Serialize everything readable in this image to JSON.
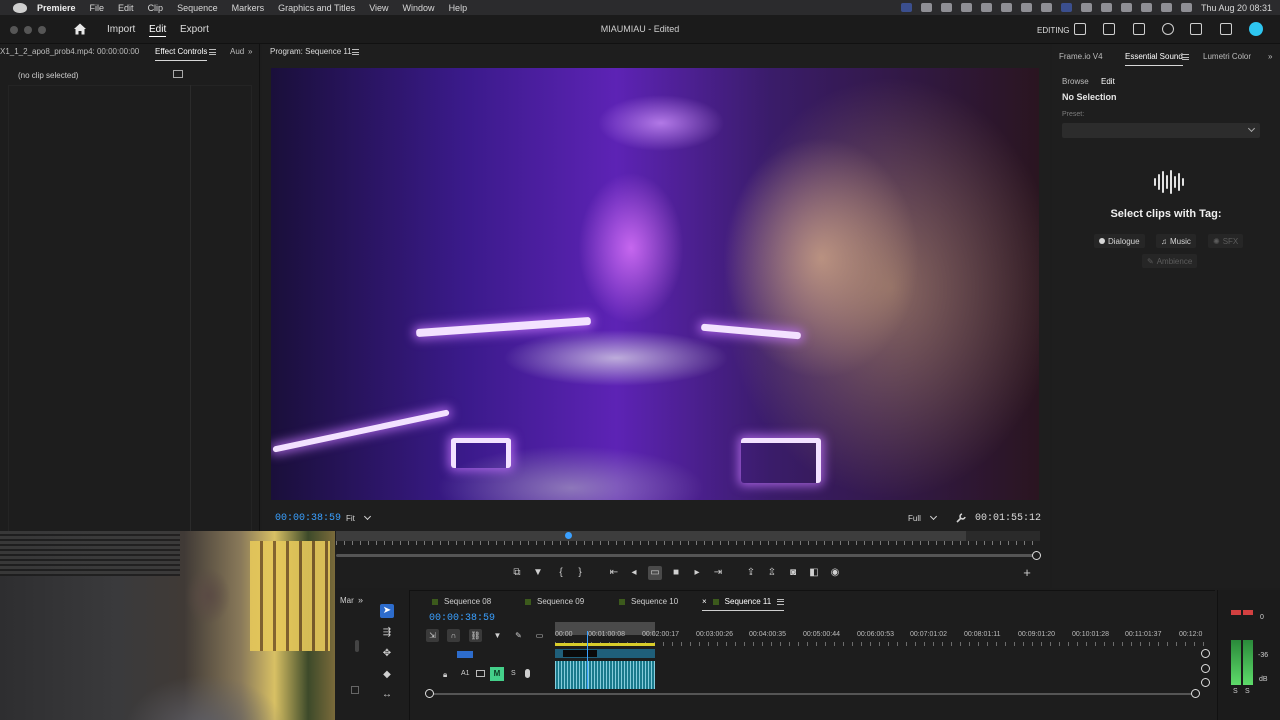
{
  "menubar": {
    "app": "Premiere",
    "items": [
      "File",
      "Edit",
      "Clip",
      "Sequence",
      "Markers",
      "Graphics and Titles",
      "View",
      "Window",
      "Help"
    ],
    "clock": "Thu Aug 20  08:31"
  },
  "header": {
    "nav": {
      "import": "Import",
      "edit": "Edit",
      "export": "Export"
    },
    "title": "MIAUMIAU - Edited",
    "workspace": "EDITING"
  },
  "left_panel": {
    "tabs": [
      "X1_1_2_apo8_prob4.mp4: 00:00:00:00",
      "Effect Controls",
      "Aud"
    ],
    "empty_text": "(no clip selected)"
  },
  "program": {
    "tab": "Program: Sequence 11",
    "timecode_current": "00:00:38:59",
    "zoom": "Fit",
    "resolution": "Full",
    "timecode_duration": "00:01:55:12",
    "playhead_fraction": 0.33
  },
  "right_panel": {
    "tabs": [
      "Frame.io V4",
      "Essential Sound",
      "Lumetri Color"
    ],
    "subtabs": [
      "Browse",
      "Edit"
    ],
    "no_selection": "No Selection",
    "preset_label": "Preset:",
    "select_clips": "Select clips with Tag:",
    "tags": {
      "dialogue": "Dialogue",
      "music": "Music",
      "sfx": "SFX",
      "ambience": "Ambience"
    }
  },
  "timeline": {
    "markers_tab": "Mar",
    "sequences": [
      "Sequence 08",
      "Sequence 09",
      "Sequence 10",
      "Sequence 11"
    ],
    "timecode": "00:00:38:59",
    "ruler": [
      "00:00",
      "00:01:00:08",
      "00:02:00:17",
      "00:03:00:26",
      "00:04:00:35",
      "00:05:00:44",
      "00:06:00:53",
      "00:07:01:02",
      "00:08:01:11",
      "00:09:01:20",
      "00:10:01:28",
      "00:11:01:37",
      "00:12:0"
    ],
    "track_a1": "A1",
    "mute": "M",
    "solo": "S"
  },
  "meters": {
    "zero": "0",
    "minus36": "-36",
    "db": "dB",
    "s1": "S",
    "s2": "S"
  },
  "colors": {
    "accent": "#3aa0ff",
    "mute_green": "#44d08a",
    "avatar": "#2ec6f0"
  }
}
